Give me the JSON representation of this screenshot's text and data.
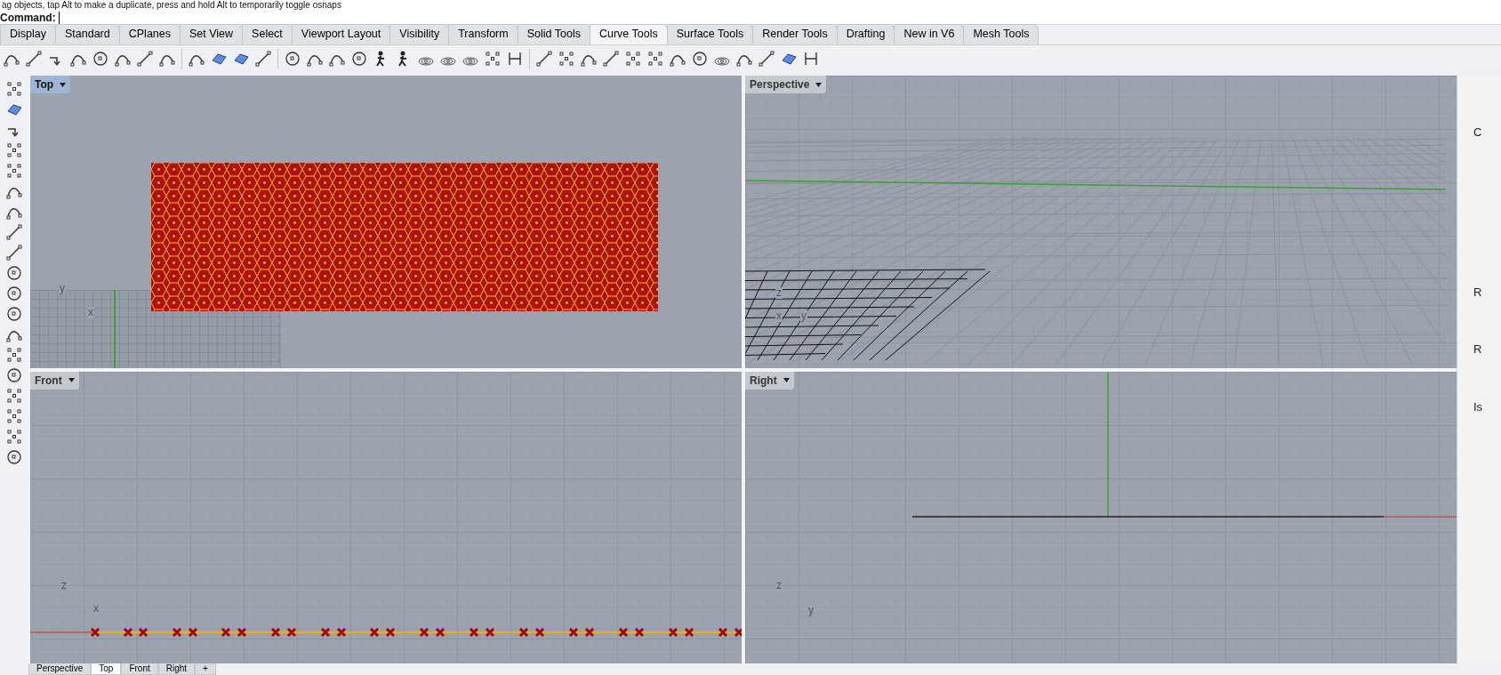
{
  "prompt_line": "ag objects, tap Alt to make a duplicate, press and hold Alt to temporarily toggle osnaps",
  "command": {
    "label": "Command:"
  },
  "toolbar_tabs": [
    {
      "label": "Display",
      "selected": false
    },
    {
      "label": "Standard",
      "selected": false
    },
    {
      "label": "CPlanes",
      "selected": false
    },
    {
      "label": "Set View",
      "selected": false
    },
    {
      "label": "Select",
      "selected": false
    },
    {
      "label": "Viewport Layout",
      "selected": false
    },
    {
      "label": "Visibility",
      "selected": false
    },
    {
      "label": "Transform",
      "selected": false
    },
    {
      "label": "Solid Tools",
      "selected": false
    },
    {
      "label": "Curve Tools",
      "selected": true
    },
    {
      "label": "Surface Tools",
      "selected": false
    },
    {
      "label": "Render Tools",
      "selected": false
    },
    {
      "label": "Drafting",
      "selected": false
    },
    {
      "label": "New in V6",
      "selected": false
    },
    {
      "label": "Mesh Tools",
      "selected": false
    }
  ],
  "viewports": [
    {
      "title": "Top",
      "kind": "top",
      "selected": true,
      "axes": [
        "y",
        "x"
      ]
    },
    {
      "title": "Perspective",
      "kind": "perspective",
      "selected": false,
      "axes": [
        "z",
        "x",
        "y"
      ]
    },
    {
      "title": "Front",
      "kind": "front",
      "selected": false,
      "axes": [
        "z",
        "x"
      ]
    },
    {
      "title": "Right",
      "kind": "right",
      "selected": false,
      "axes": [
        "z",
        "y"
      ]
    }
  ],
  "viewport_tabs": [
    {
      "label": "Perspective",
      "selected": false
    },
    {
      "label": "Top",
      "selected": true
    },
    {
      "label": "Front",
      "selected": false
    },
    {
      "label": "Right",
      "selected": false
    },
    {
      "label": "+",
      "selected": false
    }
  ],
  "side_panel": {
    "labels": [
      "C",
      "R",
      "R",
      "Is"
    ]
  }
}
